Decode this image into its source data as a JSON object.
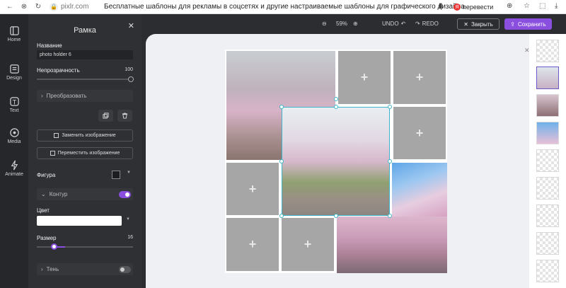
{
  "browser": {
    "url": "pixlr.com",
    "page_title": "Бесплатные шаблоны для рекламы в соцсетях и другие настраиваемые шаблоны для графического дизайна",
    "translate_label": "перевести"
  },
  "rail": [
    {
      "label": "Home",
      "icon": "home-icon"
    },
    {
      "label": "Design",
      "icon": "design-icon"
    },
    {
      "label": "Text",
      "icon": "text-icon"
    },
    {
      "label": "Media",
      "icon": "media-icon"
    },
    {
      "label": "Animate",
      "icon": "animate-icon"
    }
  ],
  "panel": {
    "title": "Рамка",
    "name_label": "Название",
    "name_value": "photo holder 6",
    "opacity_label": "Непрозрачность",
    "opacity_value": "100",
    "transform_label": "Преобразовать",
    "replace_image_label": "Заменить изображение",
    "move_image_label": "Переместить изображение",
    "shape_label": "Фигура",
    "outline_label": "Контур",
    "outline_on": true,
    "color_label": "Цвет",
    "color_value": "#ffffff",
    "size_label": "Размер",
    "size_value": "16",
    "size_fraction": 0.18,
    "shadow_label": "Тень",
    "shadow_on": false
  },
  "toolbar": {
    "zoom": "59%",
    "undo_label": "UNDO",
    "redo_label": "REDO",
    "close_label": "Закрыть",
    "save_label": "Сохранить"
  },
  "colors": {
    "accent": "#8b4fe0",
    "selection": "#3cb6c8",
    "panel_bg": "#2e3034",
    "canvas_bg": "#eef0f3"
  },
  "pages": {
    "count": 9,
    "active_index": 1
  }
}
